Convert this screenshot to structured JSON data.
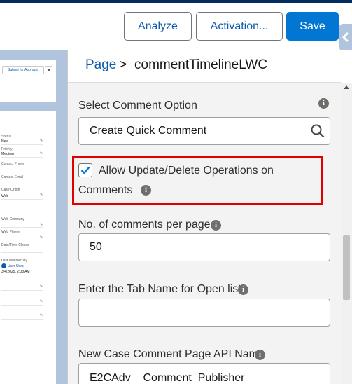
{
  "header": {
    "analyze_label": "Analyze",
    "activation_label": "Activation...",
    "save_label": "Save"
  },
  "canvas_preview": {
    "submit_label": "Submit for Approval",
    "fields": [
      {
        "label": "Status",
        "value": "New"
      },
      {
        "label": "Priority",
        "value": "Medium"
      },
      {
        "label": "Contact Phone",
        "value": ""
      },
      {
        "label": "Contact Email",
        "value": ""
      },
      {
        "label": "Case Origin",
        "value": "Web"
      },
      {
        "label": "Web Company",
        "value": ""
      },
      {
        "label": "Web Phone",
        "value": ""
      },
      {
        "label": "Date/Time Closed",
        "value": ""
      },
      {
        "label": "Last Modified By",
        "value": "User User,"
      },
      {
        "label": "",
        "value": "3/4/2025, 2:08 AM"
      }
    ]
  },
  "panel": {
    "breadcrumb": {
      "page": "Page",
      "separator": ">",
      "current": "commentTimelineLWC"
    },
    "select_comment_option": {
      "label": "Select Comment Option",
      "value": "Create Quick Comment"
    },
    "allow_update_delete": {
      "label_line1": "Allow Update/Delete Operations on",
      "label_line2": "Comments",
      "checked": true
    },
    "comments_per_page": {
      "label": "No. of comments per page",
      "value": "50"
    },
    "open_list_tab": {
      "label": "Enter the Tab Name for Open list",
      "value": ""
    },
    "new_case_comment_page": {
      "label": "New Case Comment Page API Name",
      "value": "E2CAdv__Comment_Publisher"
    }
  },
  "colors": {
    "brand": "#0176d3",
    "highlight": "#e00000",
    "canvas_bg": "#b0c4de",
    "top_strip": "#032d60"
  },
  "icons": [
    "info-icon",
    "search-icon",
    "checkmark-icon",
    "chevron-down-icon",
    "pencil-icon",
    "collapse-arrow-icon",
    "scroll-up-arrow-icon"
  ]
}
